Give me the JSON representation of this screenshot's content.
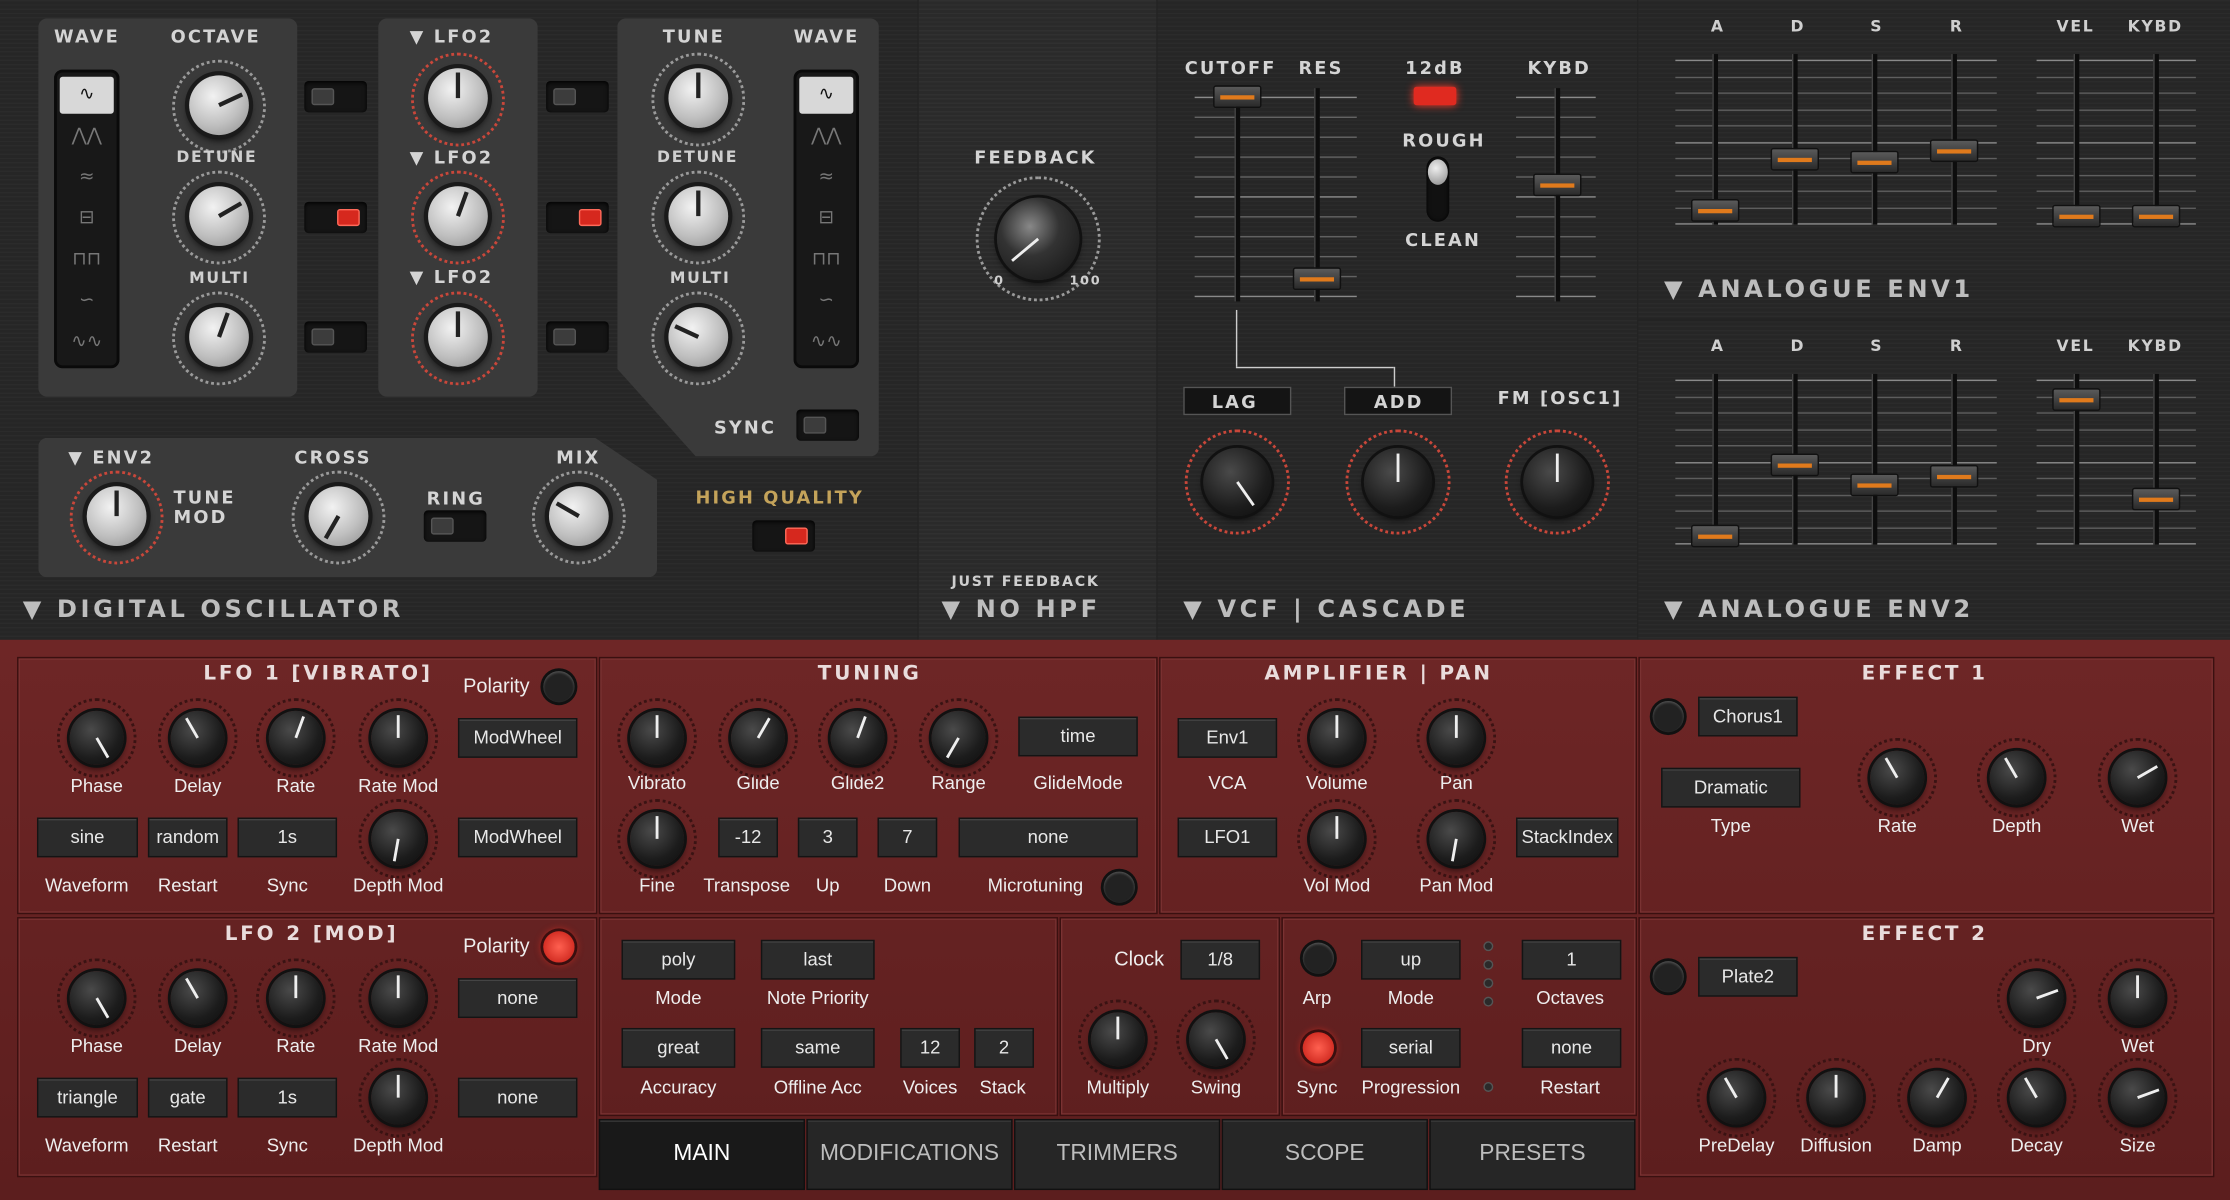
{
  "osc": {
    "wave_left": "WAVE",
    "octave": "OCTAVE",
    "detune": "DETUNE",
    "multi": "MULTI",
    "lfo_a": "LFO2",
    "lfo_b": "LFO2",
    "lfo_c": "LFO2",
    "tune": "TUNE",
    "wave_right": "WAVE",
    "detune_r": "DETUNE",
    "multi_r": "MULTI",
    "sync": "SYNC",
    "env2": "ENV2",
    "tune_mod": "TUNE MOD",
    "cross": "CROSS",
    "ring": "RING",
    "mix": "MIX",
    "high_quality": "HIGH QUALITY",
    "title": "DIGITAL OSCILLATOR",
    "wave_icons": [
      "∿",
      "⋀⋀",
      "≈",
      "⊟",
      "⊓⊓",
      "∽",
      "∿∿"
    ]
  },
  "feedback": {
    "label": "FEEDBACK",
    "min": "0",
    "max": "100",
    "sub": "JUST FEEDBACK",
    "title": "NO HPF"
  },
  "vcf": {
    "cutoff": "CUTOFF",
    "res": "RES",
    "db": "12dB",
    "rough": "ROUGH",
    "clean": "CLEAN",
    "kybd": "KYBD",
    "lag": "LAG",
    "add": "ADD",
    "fm": "FM [OSC1]",
    "title": "VCF | CASCADE"
  },
  "env1": {
    "a": "A",
    "d": "D",
    "s": "S",
    "r": "R",
    "vel": "VEL",
    "kybd": "KYBD",
    "title": "ANALOGUE ENV1"
  },
  "env2p": {
    "a": "A",
    "d": "D",
    "s": "S",
    "r": "R",
    "vel": "VEL",
    "kybd": "KYBD",
    "title": "ANALOGUE ENV2"
  },
  "lfo1": {
    "title": "LFO 1 [VIBRATO]",
    "polarity": "Polarity",
    "phase": "Phase",
    "delay": "Delay",
    "rate": "Rate",
    "rate_mod": "Rate Mod",
    "mod1": "ModWheel",
    "waveform_val": "sine",
    "restart_val": "random",
    "sync_val": "1s",
    "mod2": "ModWheel",
    "waveform": "Waveform",
    "restart": "Restart",
    "sync": "Sync",
    "depth_mod": "Depth Mod"
  },
  "lfo2": {
    "title": "LFO 2 [MOD]",
    "polarity": "Polarity",
    "phase": "Phase",
    "delay": "Delay",
    "rate": "Rate",
    "rate_mod": "Rate Mod",
    "mod1": "none",
    "waveform_val": "triangle",
    "restart_val": "gate",
    "sync_val": "1s",
    "mod2": "none",
    "waveform": "Waveform",
    "restart": "Restart",
    "sync": "Sync",
    "depth_mod": "Depth Mod"
  },
  "tuning": {
    "title": "TUNING",
    "vibrato": "Vibrato",
    "glide": "Glide",
    "glide2": "Glide2",
    "range": "Range",
    "glidemode_val": "time",
    "glidemode": "GlideMode",
    "fine": "Fine",
    "transpose_val": "-12",
    "up_val": "3",
    "down_val": "7",
    "micro_val": "none",
    "transpose": "Transpose",
    "up": "Up",
    "down": "Down",
    "microtuning": "Microtuning"
  },
  "amp": {
    "title": "AMPLIFIER | PAN",
    "vca_val": "Env1",
    "vca": "VCA",
    "volume": "Volume",
    "pan": "Pan",
    "lfo_val": "LFO1",
    "volmod": "Vol Mod",
    "panmod": "Pan Mod",
    "stack": "StackIndex"
  },
  "voice": {
    "mode_val": "poly",
    "mode": "Mode",
    "prio_val": "last",
    "prio": "Note Priority",
    "acc_val": "great",
    "acc": "Accuracy",
    "offacc_val": "same",
    "offacc": "Offline Acc",
    "voices_val": "12",
    "voices": "Voices",
    "stack_val": "2",
    "stack": "Stack"
  },
  "clock": {
    "label": "Clock",
    "val": "1/8",
    "multiply": "Multiply",
    "swing": "Swing"
  },
  "arp": {
    "arp": "Arp",
    "mode_val": "up",
    "mode": "Mode",
    "oct_val": "1",
    "octaves": "Octaves",
    "sync": "Sync",
    "prog_val": "serial",
    "progression": "Progression",
    "restart_val": "none",
    "restart": "Restart"
  },
  "fx1": {
    "title": "EFFECT 1",
    "preset": "Chorus1",
    "type_val": "Dramatic",
    "type": "Type",
    "rate": "Rate",
    "depth": "Depth",
    "wet": "Wet"
  },
  "fx2": {
    "title": "EFFECT 2",
    "preset": "Plate2",
    "dry": "Dry",
    "wet": "Wet",
    "predelay": "PreDelay",
    "diffusion": "Diffusion",
    "damp": "Damp",
    "decay": "Decay",
    "size": "Size"
  },
  "tabs": [
    "MAIN",
    "MODIFICATIONS",
    "TRIMMERS",
    "SCOPE",
    "PRESETS"
  ]
}
